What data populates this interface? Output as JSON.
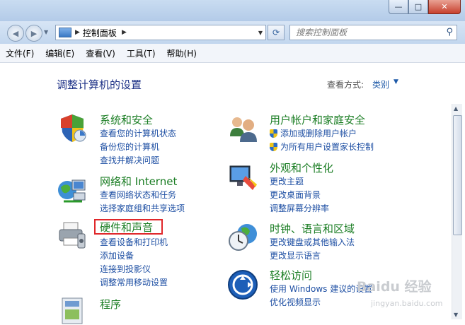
{
  "address": {
    "crumbs": [
      "控制面板"
    ]
  },
  "search": {
    "placeholder": "搜索控制面板"
  },
  "menu": [
    "文件(F)",
    "编辑(E)",
    "查看(V)",
    "工具(T)",
    "帮助(H)"
  ],
  "main": {
    "heading": "调整计算机的设置",
    "view_by_label": "查看方式:",
    "view_by_value": "类别"
  },
  "categories": [
    {
      "title": "系统和安全",
      "icon": "shield-icon",
      "links": [
        "查看您的计算机状态",
        "备份您的计算机",
        "查找并解决问题"
      ]
    },
    {
      "title": "网络和 Internet",
      "icon": "network-globe-icon",
      "links": [
        "查看网络状态和任务",
        "选择家庭组和共享选项"
      ]
    },
    {
      "title": "硬件和声音",
      "icon": "printer-icon",
      "links": [
        "查看设备和打印机",
        "添加设备",
        "连接到投影仪",
        "调整常用移动设置"
      ]
    },
    {
      "title": "程序",
      "icon": "programs-icon",
      "links": []
    },
    {
      "title": "用户帐户和家庭安全",
      "icon": "users-icon",
      "links": [
        "添加或删除用户帐户",
        "为所有用户设置家长控制"
      ]
    },
    {
      "title": "外观和个性化",
      "icon": "monitor-paint-icon",
      "links": [
        "更改主题",
        "更改桌面背景",
        "调整屏幕分辨率"
      ]
    },
    {
      "title": "时钟、语言和区域",
      "icon": "clock-globe-icon",
      "links": [
        "更改键盘或其他输入法",
        "更改显示语言"
      ]
    },
    {
      "title": "轻松访问",
      "icon": "ease-of-access-icon",
      "links": [
        "使用 Windows 建议的设置",
        "优化视频显示"
      ]
    }
  ],
  "watermark": {
    "line1": "Baidu 经验",
    "line2": "jingyan.baidu.com"
  }
}
